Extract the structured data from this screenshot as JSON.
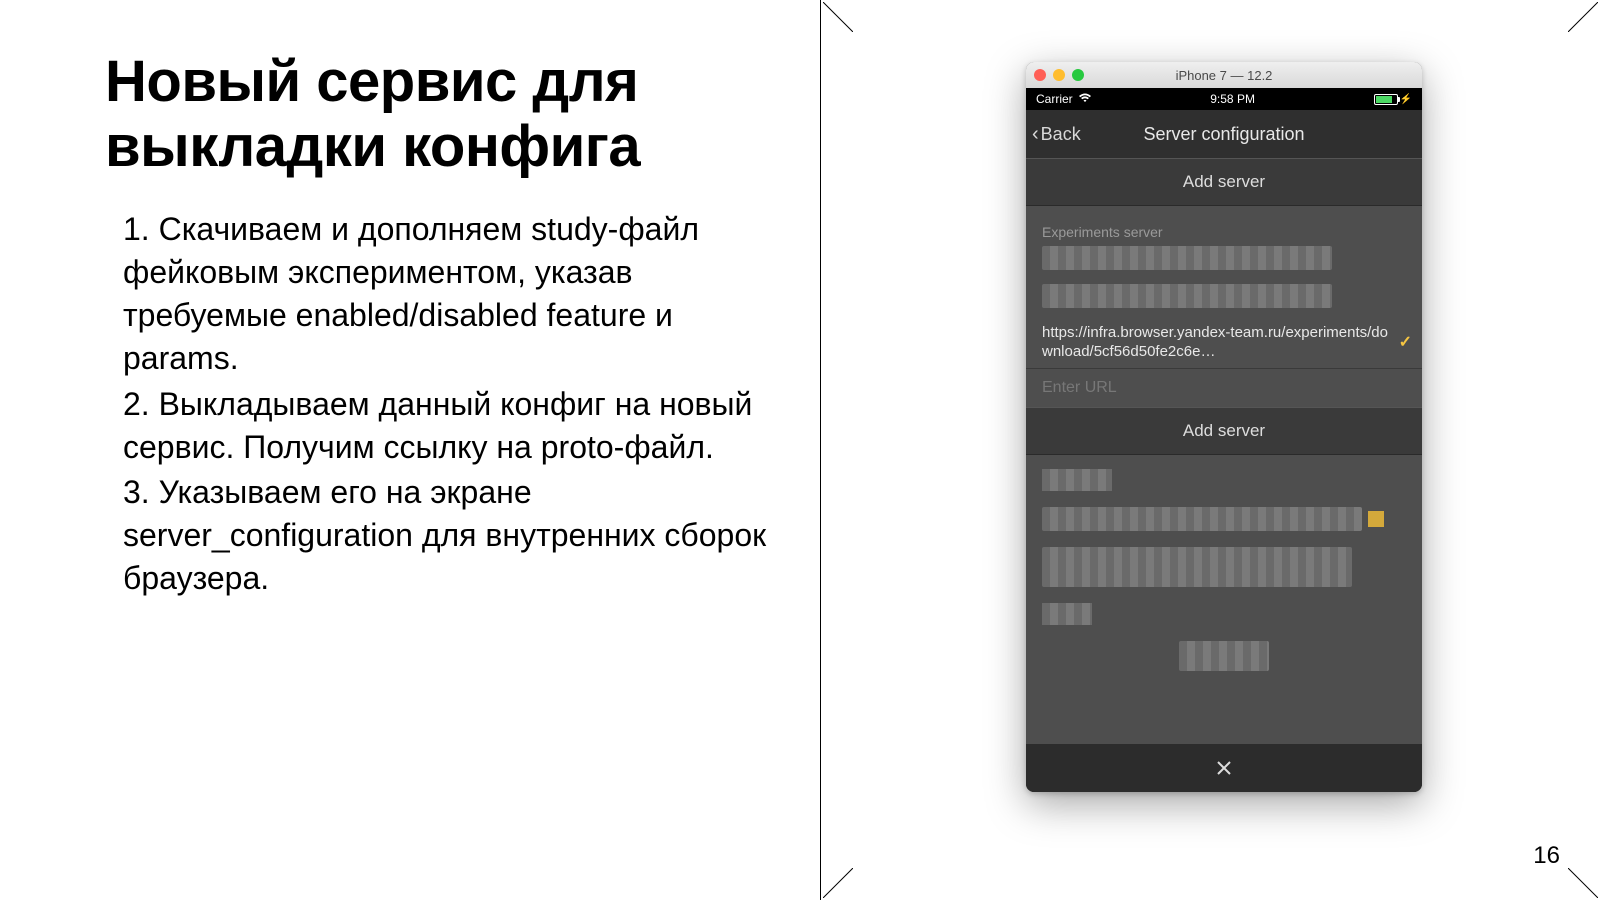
{
  "title": "Новый сервис для выкладки конфига",
  "steps": [
    "Скачиваем и дополняем study-файл фейковым экспериментом, указав требуемые enabled/disabled feature и params.",
    "Выкладываем данный конфиг на новый сервис. Получим ссылку на proto-файл.",
    "Указываем его на экране server_configuration для внутренних сборок браузера."
  ],
  "page_number": "16",
  "simulator": {
    "window_title": "iPhone 7 — 12.2",
    "statusbar": {
      "carrier": "Carrier",
      "time": "9:58 PM"
    },
    "nav": {
      "back": "Back",
      "title": "Server configuration"
    },
    "add_server_top": "Add server",
    "section_label": "Experiments server",
    "selected_url": "https://infra.browser.yandex-team.ru/experiments/download/5cf56d50fe2c6e…",
    "enter_url_placeholder": "Enter URL",
    "add_server_bottom": "Add server"
  }
}
